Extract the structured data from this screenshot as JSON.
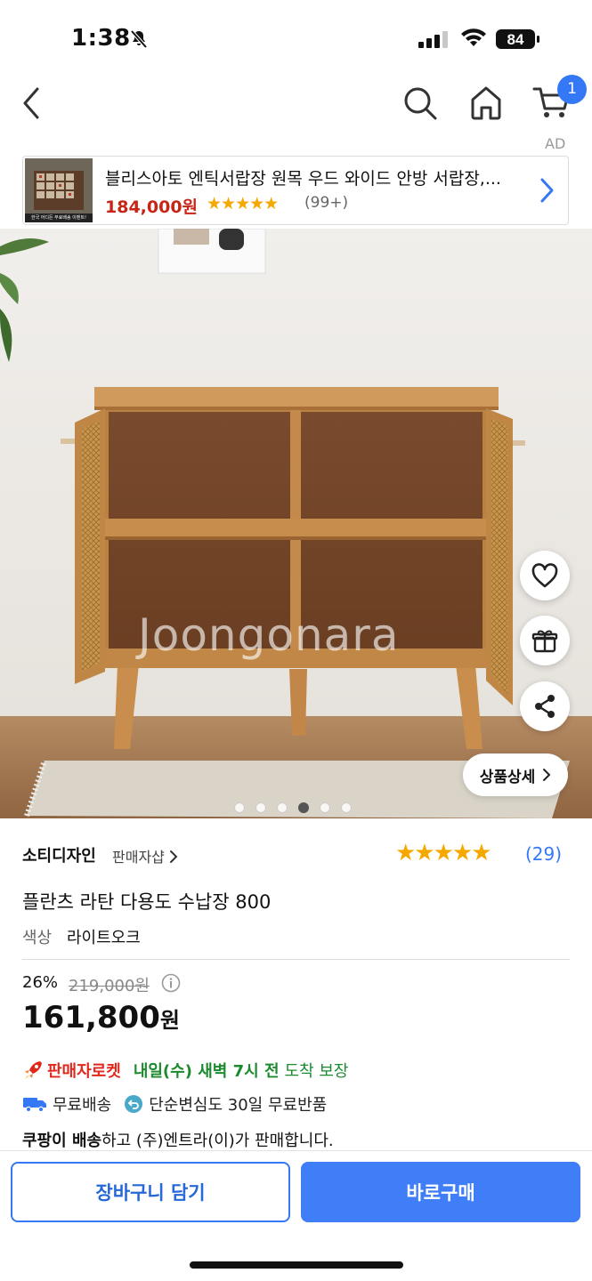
{
  "status_bar": {
    "time": "1:38",
    "battery": "84"
  },
  "nav": {
    "cart_count": "1",
    "ad_label": "AD"
  },
  "ad_banner": {
    "title": "블리스아토 엔틱서랍장 원목 우드 와이드 안방 서랍장,...",
    "price": "184,000원",
    "rating": 4.5,
    "stars": "★★★★★",
    "reviews": "(99+)",
    "thumb_caption": "한국 어디든 무료배송 이벤트!"
  },
  "hero": {
    "watermark": "Joongonara",
    "detail_button": "상품상세",
    "carousel_count": 6,
    "carousel_active": 4
  },
  "product": {
    "seller": "소티디자인",
    "seller_shop": "판매자샵",
    "rating": 4.5,
    "stars": "★★★★★",
    "rating_count": "(29)",
    "name": "플란츠 라탄 다용도 수납장 800",
    "color_label": "색상",
    "color_value": "라이트오크",
    "discount": "26%",
    "original_price": "219,000원",
    "price_number": "161,800",
    "price_unit": "원",
    "delivery_badge": "판매자로켓",
    "delivery_date": "내일(수) 새벽 7시 전",
    "delivery_suffix": "도착 보장",
    "free_shipping": "무료배송",
    "free_return": "단순변심도 30일 무료반품",
    "seller_line_bold": "쿠팡이 배송",
    "seller_line_rest": "하고 (주)엔트라(이)가 판매합니다."
  },
  "actions": {
    "add_to_cart": "장바구니 담기",
    "buy_now": "바로구매"
  },
  "colors": {
    "accent": "#3478f6",
    "star": "#f5a800",
    "ad_price": "#c72515",
    "delivery_green": "#1c8a2e",
    "rocket_red": "#e0281c"
  }
}
